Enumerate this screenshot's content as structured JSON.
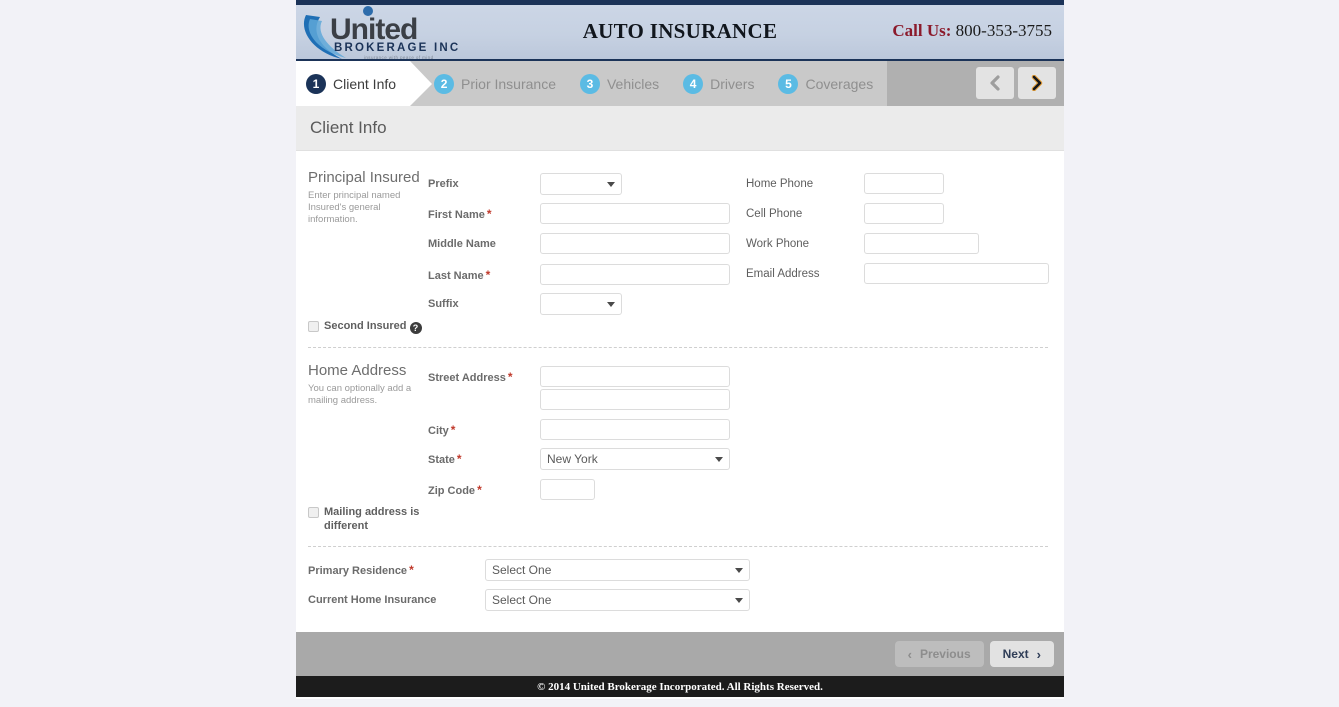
{
  "header": {
    "logo_name": "United",
    "logo_sub": "BROKERAGE INC",
    "logo_tagline": "insurance with peace of mind",
    "title": "AUTO INSURANCE",
    "call_us_label": "Call Us:",
    "phone": "800-353-3755"
  },
  "wizard": {
    "steps": [
      {
        "num": "1",
        "label": "Client Info",
        "active": true
      },
      {
        "num": "2",
        "label": "Prior Insurance",
        "active": false
      },
      {
        "num": "3",
        "label": "Vehicles",
        "active": false
      },
      {
        "num": "4",
        "label": "Drivers",
        "active": false
      },
      {
        "num": "5",
        "label": "Coverages",
        "active": false
      }
    ],
    "prev_arrow": "back-arrow",
    "next_arrow": "forward-arrow"
  },
  "page": {
    "title": "Client Info"
  },
  "principal_insured": {
    "section_title": "Principal Insured",
    "section_desc": "Enter principal named Insured's general information.",
    "prefix_label": "Prefix",
    "prefix_value": "",
    "first_name_label": "First Name",
    "first_name_value": "",
    "middle_name_label": "Middle Name",
    "middle_name_value": "",
    "last_name_label": "Last Name",
    "last_name_value": "",
    "suffix_label": "Suffix",
    "suffix_value": "",
    "home_phone_label": "Home Phone",
    "home_phone_value": "",
    "cell_phone_label": "Cell Phone",
    "cell_phone_value": "",
    "work_phone_label": "Work Phone",
    "work_phone_value": "",
    "email_label": "Email Address",
    "email_value": "",
    "second_insured_label": "Second Insured",
    "help_glyph": "?"
  },
  "home_address": {
    "section_title": "Home Address",
    "section_desc": "You can optionally add a mailing address.",
    "street_label": "Street Address",
    "street_value": "",
    "street2_value": "",
    "city_label": "City",
    "city_value": "",
    "state_label": "State",
    "state_value": "New York",
    "zip_label": "Zip Code",
    "zip_value": "",
    "mailing_diff_label": "Mailing address is different"
  },
  "residence": {
    "primary_label": "Primary Residence",
    "primary_value": "Select One",
    "home_ins_label": "Current Home Insurance",
    "home_ins_value": "Select One"
  },
  "actions": {
    "previous_label": "Previous",
    "next_label": "Next",
    "prev_chev": "‹",
    "next_chev": "›"
  },
  "footer": {
    "copyright": "© 2014 United Brokerage Incorporated. All Rights Reserved."
  },
  "required_marker": "*",
  "colors": {
    "brand_navy": "#1b3358",
    "step_blue": "#5bbbe4",
    "required_red": "#c0392b",
    "call_red": "#8b1a2b"
  }
}
